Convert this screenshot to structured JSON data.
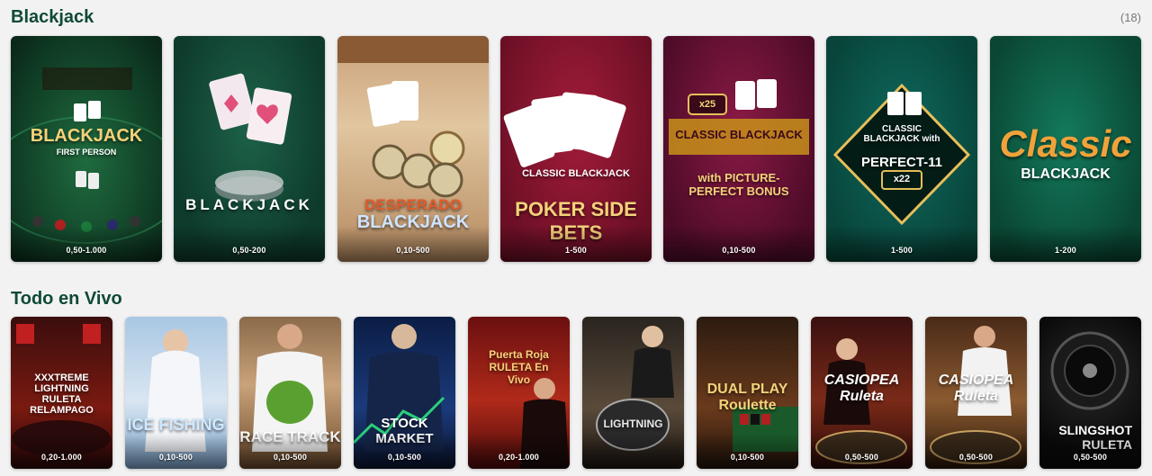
{
  "sections": {
    "blackjack": {
      "title": "Blackjack",
      "count": "(18)",
      "games": [
        {
          "logo_line1": "BLACKJACK",
          "logo_line2": "FIRST PERSON",
          "limit": "0,50-1.000"
        },
        {
          "logo_line1": "BLACKJACK",
          "logo_line2": "",
          "limit": "0,50-200"
        },
        {
          "logo_line1": "DESPERADO",
          "logo_line2": "BLACKJACK",
          "limit": "0,10-500"
        },
        {
          "logo_line1": "CLASSIC BLACKJACK",
          "logo_line2": "POKER SIDE BETS",
          "limit": "1-500"
        },
        {
          "logo_line1": "CLASSIC BLACKJACK",
          "logo_line2": "with PICTURE-PERFECT BONUS",
          "badge": "x25",
          "limit": "0,10-500"
        },
        {
          "logo_line1": "CLASSIC BLACKJACK with",
          "logo_line2": "PERFECT-11",
          "badge": "x22",
          "limit": "1-500"
        },
        {
          "logo_line1": "Classic",
          "logo_line2": "BLACKJACK",
          "limit": "1-200"
        }
      ]
    },
    "live": {
      "title": "Todo en Vivo",
      "games": [
        {
          "logo": "XXXTREME LIGHTNING RULETA RELAMPAGO",
          "limit": "0,20-1.000"
        },
        {
          "logo": "ICE FISHING",
          "limit": "0,10-500"
        },
        {
          "logo": "RACE TRACK",
          "limit": "0,10-500"
        },
        {
          "logo": "STOCK MARKET",
          "limit": "0,10-500"
        },
        {
          "logo": "Puerta Roja RULETA En Vivo",
          "limit": "0,20-1.000"
        },
        {
          "logo": "LIGHTNING",
          "limit": ""
        },
        {
          "logo": "DUAL PLAY Roulette",
          "limit": "0,10-500"
        },
        {
          "logo": "CASIOPEA Ruleta",
          "limit": "0,50-500"
        },
        {
          "logo": "CASIOPEA Ruleta",
          "limit": "0,50-500"
        },
        {
          "logo": "SLINGSHOT RULETA",
          "limit": "0,50-500"
        }
      ]
    }
  },
  "colors": {
    "title": "#0f4a35",
    "background": "#f2f2f2",
    "gold": "#f5d27a"
  }
}
